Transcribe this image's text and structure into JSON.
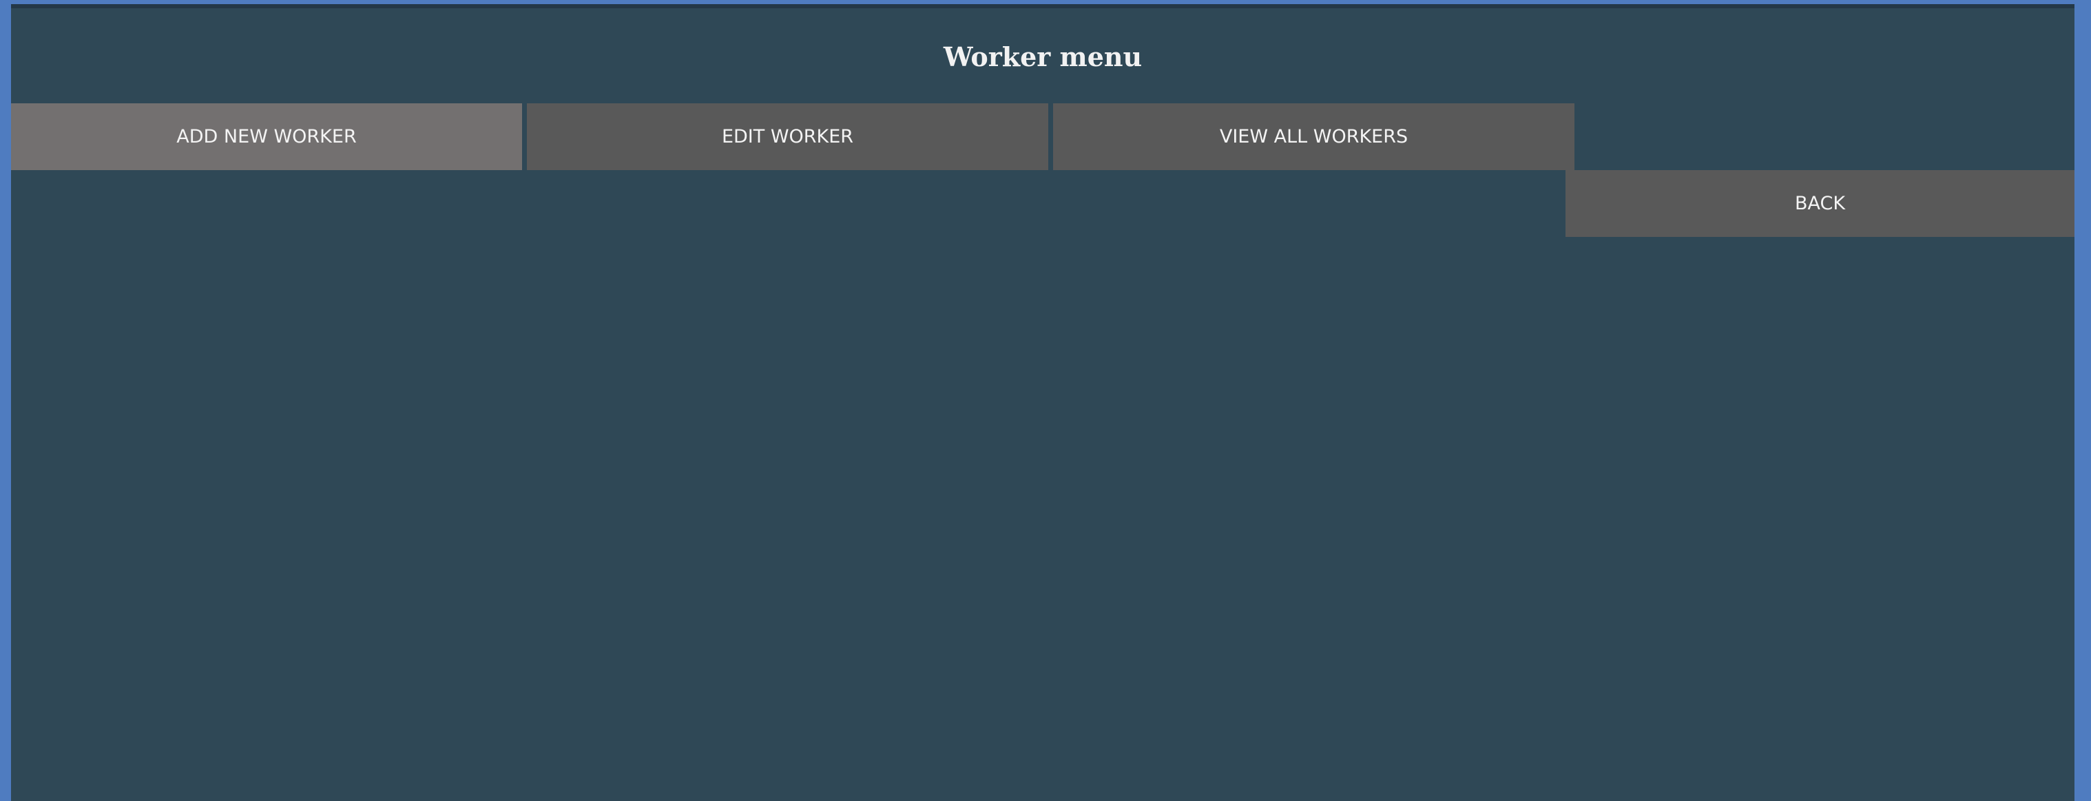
{
  "app": {
    "title": "Worker menu"
  },
  "menu": {
    "add_label": "ADD NEW WORKER",
    "edit_label": "EDIT WORKER",
    "view_label": "VIEW ALL WORKERS",
    "back_label": "BACK"
  },
  "colors": {
    "outer_background": "#4f7cc0",
    "panel_background": "#2f4856",
    "button": "#595959",
    "button_active": "#737070",
    "text": "#f2f2f2"
  }
}
